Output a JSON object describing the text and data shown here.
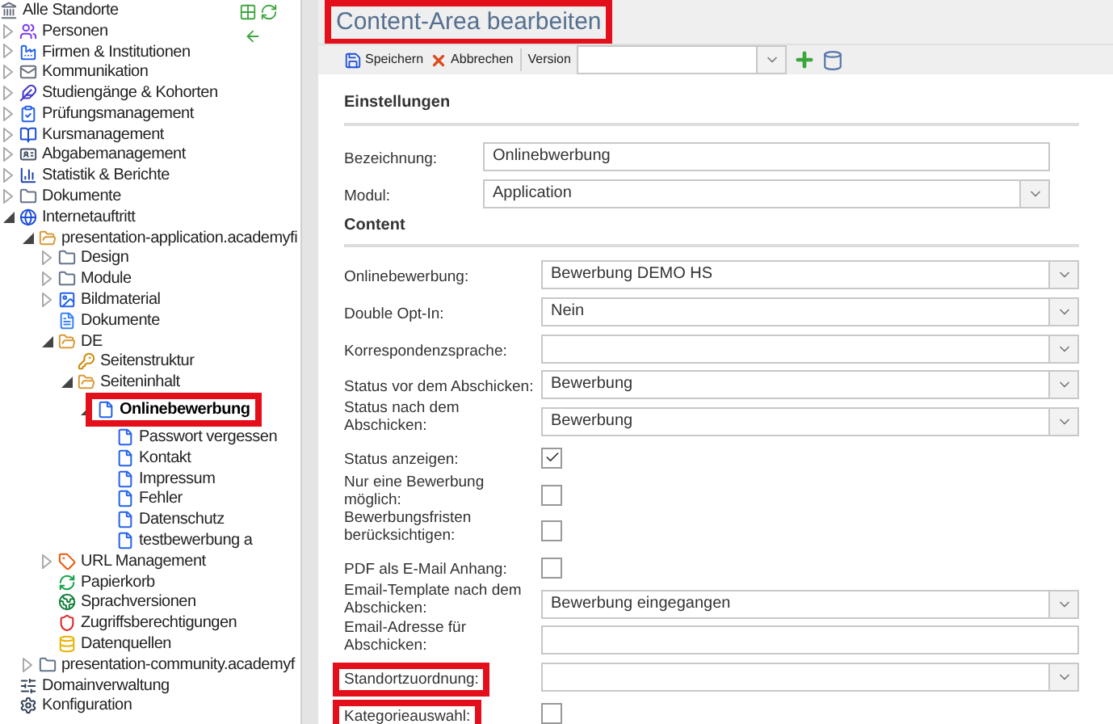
{
  "tree": [
    {
      "label": "Alle Standorte",
      "kind": "root",
      "selected": false,
      "highlighted": false,
      "children": [
        {
          "label": "Personen",
          "kind": "people",
          "expanded": false,
          "selected": false,
          "highlighted": false
        },
        {
          "label": "Firmen & Institutionen",
          "kind": "factory",
          "expanded": false,
          "selected": false,
          "highlighted": false
        },
        {
          "label": "Kommunikation",
          "kind": "mail",
          "expanded": false,
          "selected": false,
          "highlighted": false
        },
        {
          "label": "Studiengänge & Kohorten",
          "kind": "feather",
          "expanded": false,
          "selected": false,
          "highlighted": false
        },
        {
          "label": "Prüfungsmanagement",
          "kind": "exam",
          "expanded": false,
          "selected": false,
          "highlighted": false
        },
        {
          "label": "Kursmanagement",
          "kind": "book",
          "expanded": false,
          "selected": false,
          "highlighted": false
        },
        {
          "label": "Abgabemanagement",
          "kind": "card",
          "expanded": false,
          "selected": false,
          "highlighted": false
        },
        {
          "label": "Statistik & Berichte",
          "kind": "chart",
          "expanded": false,
          "selected": false,
          "highlighted": false
        },
        {
          "label": "Dokumente",
          "kind": "folder",
          "expanded": false,
          "selected": false,
          "highlighted": false
        },
        {
          "label": "Internetauftritt",
          "kind": "globe",
          "expanded": true,
          "selected": false,
          "highlighted": false,
          "children": [
            {
              "label": "presentation-application.academyfi",
              "kind": "folder-open",
              "expanded": true,
              "selected": false,
              "highlighted": false,
              "children": [
                {
                  "label": "Design",
                  "kind": "folder",
                  "expanded": false,
                  "selected": false,
                  "highlighted": false
                },
                {
                  "label": "Module",
                  "kind": "folder",
                  "expanded": false,
                  "selected": false,
                  "highlighted": false
                },
                {
                  "label": "Bildmaterial",
                  "kind": "image",
                  "expanded": false,
                  "selected": false,
                  "highlighted": false
                },
                {
                  "label": "Dokumente",
                  "kind": "doc",
                  "selected": false,
                  "highlighted": false
                },
                {
                  "label": "DE",
                  "kind": "folder-open",
                  "expanded": true,
                  "selected": false,
                  "highlighted": false,
                  "children": [
                    {
                      "label": "Seitenstruktur",
                      "kind": "key",
                      "selected": false,
                      "highlighted": false
                    },
                    {
                      "label": "Seiteninhalt",
                      "kind": "folder-open",
                      "expanded": true,
                      "selected": false,
                      "highlighted": false,
                      "children": [
                        {
                          "label": "Onlinebewerbung",
                          "kind": "page",
                          "expanded": true,
                          "selected": true,
                          "highlighted": true,
                          "children": [
                            {
                              "label": "Passwort vergessen",
                              "kind": "page",
                              "selected": false,
                              "highlighted": false
                            },
                            {
                              "label": "Kontakt",
                              "kind": "page",
                              "selected": false,
                              "highlighted": false
                            },
                            {
                              "label": "Impressum",
                              "kind": "page",
                              "selected": false,
                              "highlighted": false
                            },
                            {
                              "label": "Fehler",
                              "kind": "page",
                              "selected": false,
                              "highlighted": false
                            },
                            {
                              "label": "Datenschutz",
                              "kind": "page",
                              "selected": false,
                              "highlighted": false
                            },
                            {
                              "label": "testbewerbung a",
                              "kind": "page",
                              "selected": false,
                              "highlighted": false
                            }
                          ]
                        }
                      ]
                    }
                  ]
                },
                {
                  "label": "URL Management",
                  "kind": "tag",
                  "expanded": false,
                  "selected": false,
                  "highlighted": false
                },
                {
                  "label": "Papierkorb",
                  "kind": "recycle",
                  "selected": false,
                  "highlighted": false
                },
                {
                  "label": "Sprachversionen",
                  "kind": "earth",
                  "selected": false,
                  "highlighted": false
                },
                {
                  "label": "Zugriffsberechtigungen",
                  "kind": "shield",
                  "selected": false,
                  "highlighted": false
                },
                {
                  "label": "Datenquellen",
                  "kind": "database",
                  "selected": false,
                  "highlighted": false
                }
              ]
            },
            {
              "label": "presentation-community.academyf",
              "kind": "folder",
              "expanded": false,
              "selected": false,
              "highlighted": false
            }
          ]
        },
        {
          "label": "Domainverwaltung",
          "kind": "sliders",
          "selected": false,
          "highlighted": false
        },
        {
          "label": "Konfiguration",
          "kind": "gear",
          "selected": false,
          "highlighted": false
        }
      ]
    }
  ],
  "panel": {
    "title": "Content-Area bearbeiten",
    "title_highlighted": true,
    "toolbar": [
      {
        "label": "Speichern",
        "kind": "save"
      },
      {
        "label": "Abbrechen",
        "kind": "cancel"
      }
    ],
    "version_label": "Version"
  },
  "settings": {
    "heading": "Einstellungen",
    "fields": [
      {
        "label": "Bezeichnung:",
        "kind": "text",
        "value": "Onlinebwerbung",
        "highlighted": false
      },
      {
        "label": "Modul:",
        "kind": "select",
        "value": "Application",
        "highlighted": false
      }
    ]
  },
  "content": {
    "heading": "Content",
    "fields": [
      {
        "label": "Onlinebewerbung:",
        "kind": "select",
        "value": "Bewerbung DEMO HS",
        "highlighted": false
      },
      {
        "label": "Double Opt-In:",
        "kind": "select",
        "value": "Nein",
        "highlighted": false
      },
      {
        "label": "Korrespondenzsprache:",
        "kind": "select",
        "highlighted": false
      },
      {
        "label": "Status vor dem Abschicken:",
        "kind": "select",
        "value": "Bewerbung",
        "highlighted": false
      },
      {
        "label": "Status nach dem Abschicken:",
        "kind": "select",
        "value": "Bewerbung",
        "highlighted": false
      },
      {
        "label": "Status anzeigen:",
        "kind": "checkbox",
        "checked": true,
        "highlighted": false
      },
      {
        "label": "Nur eine Bewerbung möglich:",
        "kind": "checkbox",
        "checked": false,
        "highlighted": false
      },
      {
        "label": "Bewerbungsfristen berücksichtigen:",
        "kind": "checkbox",
        "checked": false,
        "highlighted": false
      },
      {
        "label": "PDF als E-Mail Anhang:",
        "kind": "checkbox",
        "checked": false,
        "highlighted": false
      },
      {
        "label": "Email-Template nach dem Abschicken:",
        "kind": "select",
        "value": "Bewerbung eingegangen",
        "highlighted": false
      },
      {
        "label": "Email-Adresse für Abschicken:",
        "kind": "text",
        "highlighted": false
      },
      {
        "label": "Standortzuordnung:",
        "kind": "select",
        "highlighted": true
      },
      {
        "label": "Kategorieauswahl:",
        "kind": "checkbox",
        "checked": false,
        "highlighted": true
      }
    ]
  }
}
